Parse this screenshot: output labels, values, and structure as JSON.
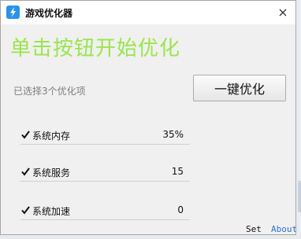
{
  "window": {
    "title": "游戏优化器",
    "icon": "lightning-icon",
    "close_icon": "close-icon"
  },
  "main": {
    "headline": "单击按钮开始优化",
    "selected_count": "已选择3个优化项",
    "optimize_button": "一键优化",
    "options": [
      {
        "label": "系统内存",
        "value": "35%",
        "checked": true
      },
      {
        "label": "系统服务",
        "value": "15",
        "checked": true
      },
      {
        "label": "系统加速",
        "value": "0",
        "checked": true
      }
    ]
  },
  "footer": {
    "set_link": "Set",
    "about_link": "About"
  },
  "colors": {
    "headline": "#99e54d",
    "about_link": "#2f6fd6",
    "icon_bg": "#2a93e6"
  }
}
